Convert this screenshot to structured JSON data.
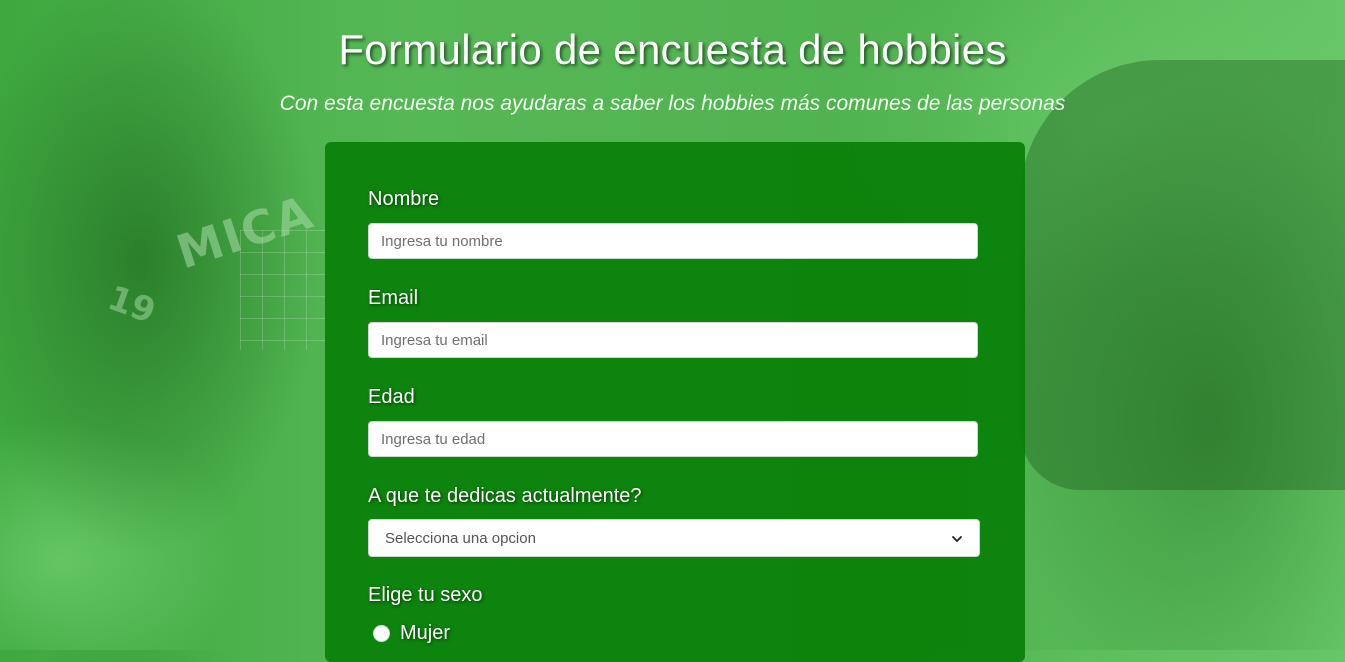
{
  "header": {
    "title": "Formulario de encuesta de hobbies",
    "subtitle": "Con esta encuesta nos ayudaras a saber los hobbies más comunes de las personas"
  },
  "background": {
    "jersey_text": "MICA",
    "jersey_number": "19"
  },
  "form": {
    "name": {
      "label": "Nombre",
      "placeholder": "Ingresa tu nombre"
    },
    "email": {
      "label": "Email",
      "placeholder": "Ingresa tu email"
    },
    "age": {
      "label": "Edad",
      "placeholder": "Ingresa tu edad"
    },
    "occupation": {
      "label": "A que te dedicas actualmente?",
      "selected": "Selecciona una opcion"
    },
    "gender": {
      "label": "Elige tu sexo",
      "options": [
        {
          "label": "Mujer"
        }
      ]
    }
  },
  "colors": {
    "panel": "#088008",
    "background": "#4fb24f",
    "text": "#ffffff"
  }
}
